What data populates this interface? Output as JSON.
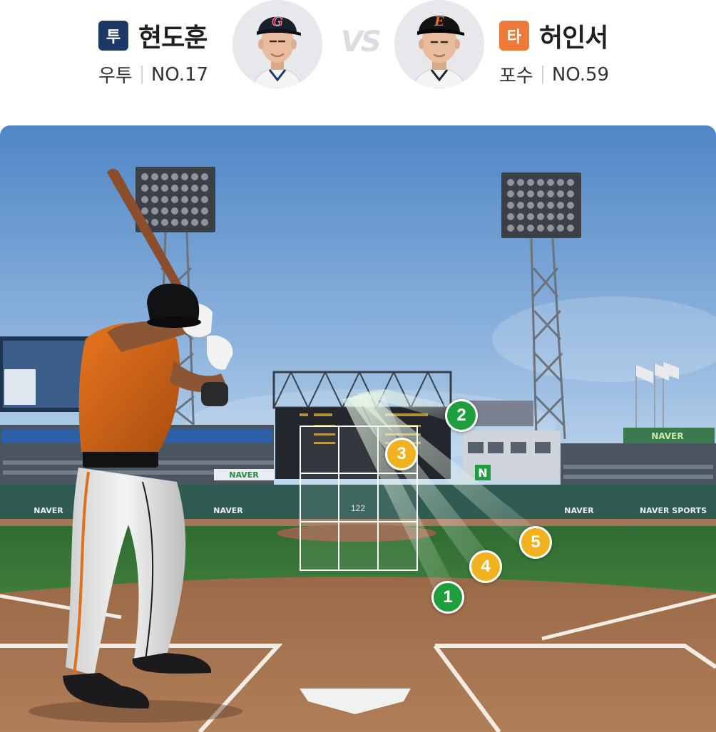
{
  "matchup": {
    "vs_label": "VS",
    "pitcher": {
      "role_badge": "투",
      "badge_color": "#1c3966",
      "name": "현도훈",
      "position": "우투",
      "number": "NO.17",
      "cap_letter": "G",
      "cap_color": "#1a1f2e",
      "cap_accent": "#c8102e"
    },
    "batter": {
      "role_badge": "타",
      "badge_color": "#ee7a3a",
      "name": "허인서",
      "position": "포수",
      "number": "NO.59",
      "cap_letter": "E",
      "cap_color": "#121212",
      "cap_accent": "#f26522"
    }
  },
  "field": {
    "pitch_count_label": "122",
    "board_sponsor": "NAVER",
    "wall_sponsors": [
      "NAVER",
      "NAVER",
      "NAVER",
      "NAVER SPORTS"
    ],
    "scoreboard_badge": "N",
    "strike_color": "#1e9e3c",
    "ball_color": "#f0b21f",
    "pitches": [
      {
        "label": "1",
        "result": "strike"
      },
      {
        "label": "2",
        "result": "strike"
      },
      {
        "label": "3",
        "result": "ball"
      },
      {
        "label": "4",
        "result": "ball"
      },
      {
        "label": "5",
        "result": "ball"
      }
    ]
  }
}
